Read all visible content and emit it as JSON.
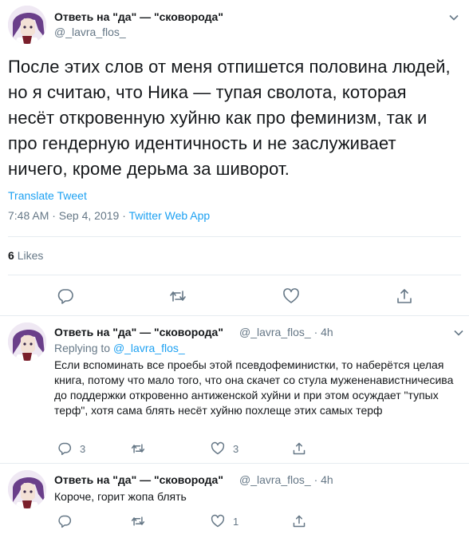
{
  "colors": {
    "link": "#1da1f2",
    "secondary_text": "#657786",
    "primary_text": "#14171a",
    "divider": "#e6ecf0"
  },
  "main_tweet": {
    "name": "Ответь на \"да\" — \"сковорода\"",
    "handle": "@_lavra_flos_",
    "text": "После этих слов от меня отпишется половина людей,\nно я считаю, что Ника — тупая сволота, которая\nнесёт откровенную хуйню как про феминизм, так и\nпро гендерную идентичность и не заслуживает\nничего, кроме дерьма за шиворот.",
    "translate_label": "Translate Tweet",
    "time": "7:48 AM · Sep 4, 2019 · ",
    "app": "Twitter Web App",
    "likes_count": "6",
    "likes_label": "Likes",
    "icons": [
      "reply-icon",
      "retweet-icon",
      "like-icon",
      "share-icon",
      "chevron-down-icon"
    ]
  },
  "replies": [
    {
      "name": "Ответь на \"да\" — \"сковорода\"",
      "handle_time": "@_lavra_flos_ · 4h",
      "replying_prefix": "Replying to ",
      "replying_to": "@_lavra_flos_",
      "text": "Если вспоминать все проебы этой псевдофеминистки, то наберётся целая книга, потому что мало того, что она скачет со стула мужененавистничесива до поддержки откровенно антиженской хуйни и при этом осуждает \"тупых терф\", хотя сама блять несёт хуйню похлеще этих самых терф",
      "reply_count": "3",
      "retweet_count": "",
      "like_count": "3"
    },
    {
      "name": "Ответь на \"да\" — \"сковорода\"",
      "handle_time": "@_lavra_flos_ · 4h",
      "text": "Короче, горит жопа блять",
      "reply_count": "",
      "retweet_count": "",
      "like_count": "1"
    }
  ]
}
